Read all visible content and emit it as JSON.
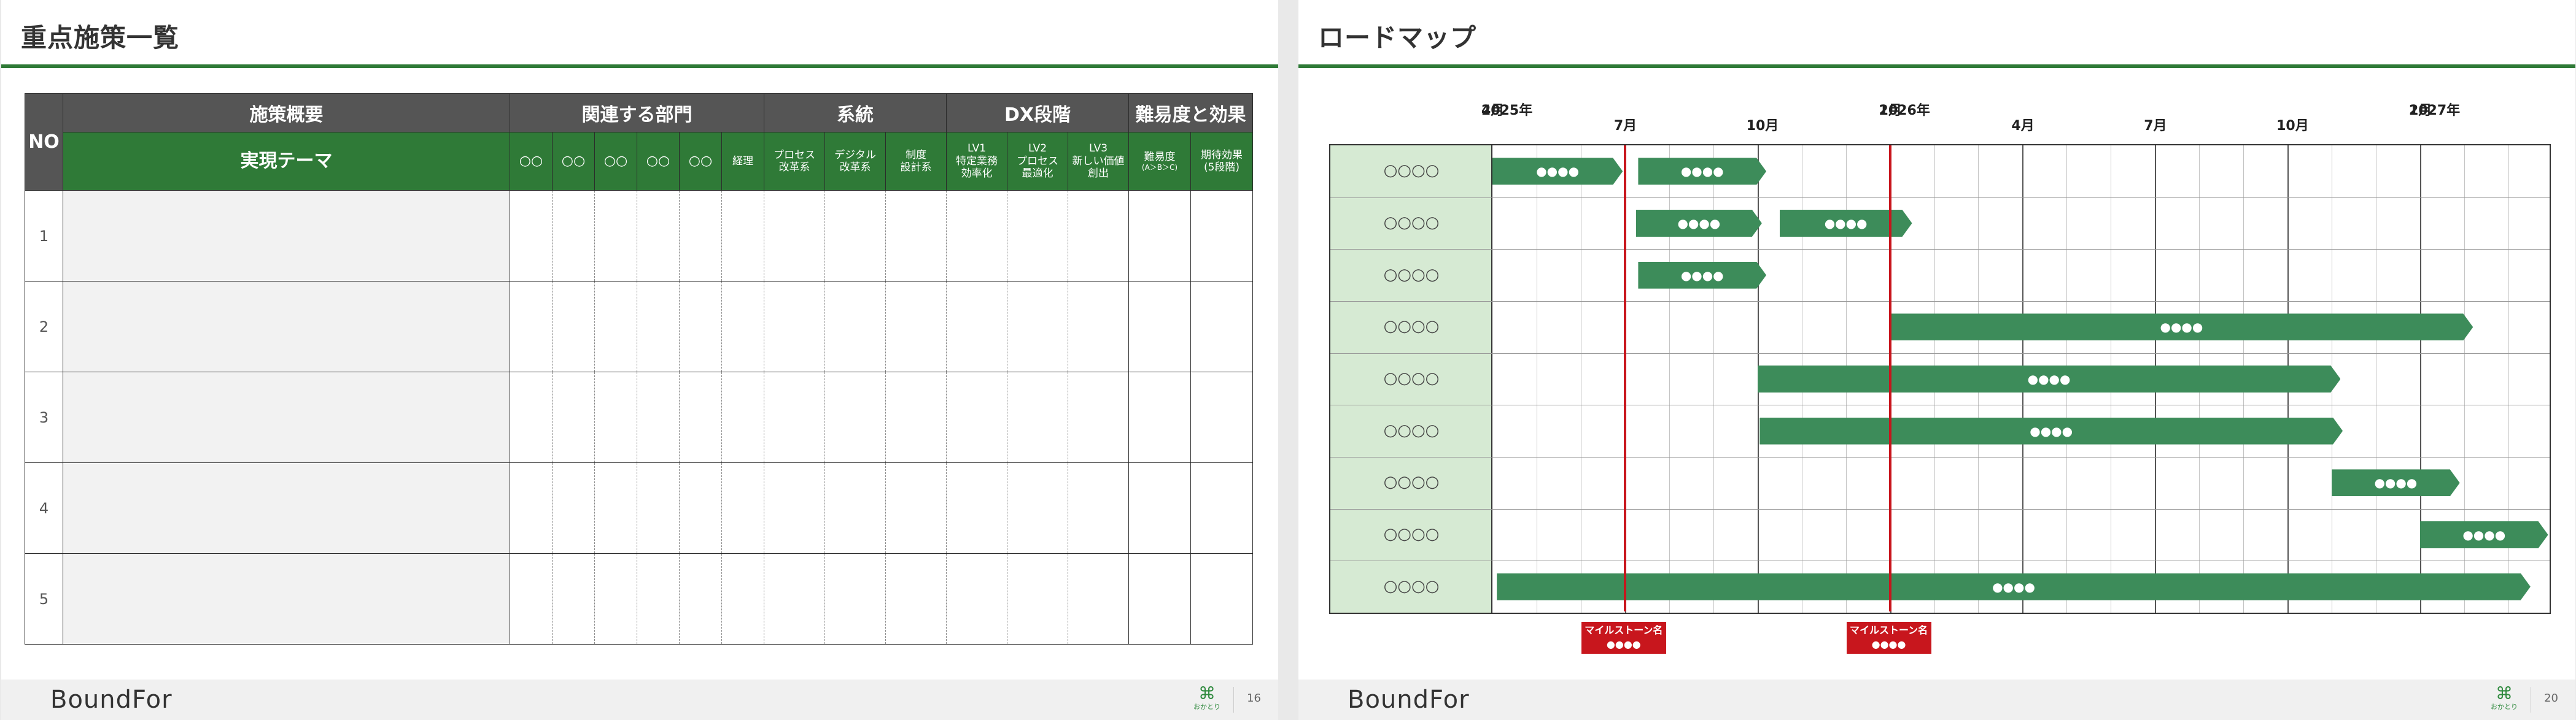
{
  "left_slide": {
    "title": "重点施策一覧",
    "logo": "BoundFor",
    "badge_mark": "⌘",
    "badge_text": "おかとり",
    "page_number": "16",
    "table": {
      "no_label": "NO",
      "group_headers": [
        "施策概要",
        "関連する部門",
        "系統",
        "DX段階",
        "難易度と効果"
      ],
      "theme_label": "実現テーマ",
      "departments": [
        "○○",
        "○○",
        "○○",
        "○○",
        "○○",
        "経理"
      ],
      "systems": [
        "プロセス\n改革系",
        "デジタル\n改革系",
        "制度\n設計系"
      ],
      "dx_levels": [
        "LV1\n特定業務\n効率化",
        "LV2\nプロセス\n最適化",
        "LV3\n新しい価値\n創出"
      ],
      "difficulty": "難易度",
      "difficulty_sub": "(A＞B＞C)",
      "effect": "期待効果",
      "effect_sub": "(5段階)",
      "rows": [
        "1",
        "2",
        "3",
        "4",
        "5"
      ]
    }
  },
  "right_slide": {
    "title": "ロードマップ",
    "logo": "BoundFor",
    "badge_mark": "⌘",
    "badge_text": "おかとり",
    "page_number": "20",
    "timeline": [
      {
        "year": "2025年",
        "month": "4月"
      },
      {
        "year": "",
        "month": "7月"
      },
      {
        "year": "",
        "month": "10月"
      },
      {
        "year": "2026年",
        "month": "1月"
      },
      {
        "year": "",
        "month": "4月"
      },
      {
        "year": "",
        "month": "7月"
      },
      {
        "year": "",
        "month": "10月"
      },
      {
        "year": "2027年",
        "month": "1月"
      }
    ],
    "rows": [
      "○○○○",
      "○○○○",
      "○○○○",
      "○○○○",
      "○○○○",
      "○○○○",
      "○○○○",
      "○○○○",
      "○○○○"
    ],
    "bar_label": "●●●●",
    "milestones": [
      {
        "name": "マイルストーン名",
        "value": "●●●●"
      },
      {
        "name": "マイルストーン名",
        "value": "●●●●"
      }
    ],
    "colors": {
      "accent": "#2f7a37",
      "bar": "#3d8c5a",
      "milestone": "#c8161d",
      "label_bg": "#d6ead3"
    }
  }
}
